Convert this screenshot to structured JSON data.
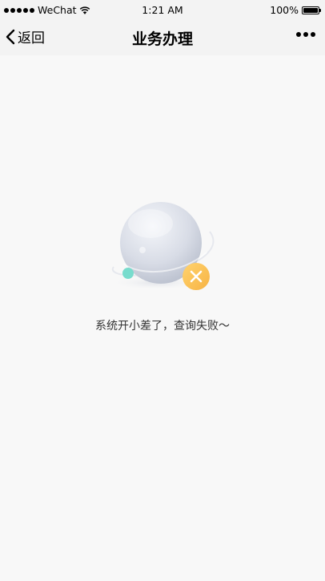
{
  "status_bar": {
    "carrier": "WeChat",
    "time": "1:21 AM",
    "battery": "100%"
  },
  "nav": {
    "back_label": "返回",
    "title": "业务办理"
  },
  "content": {
    "error_message": "系统开小差了，查询失败～"
  },
  "icons": [
    "signal-dots-icon",
    "wifi-icon",
    "battery-icon",
    "chevron-left-icon",
    "more-icon",
    "planet-error-illustration",
    "close-icon"
  ]
}
